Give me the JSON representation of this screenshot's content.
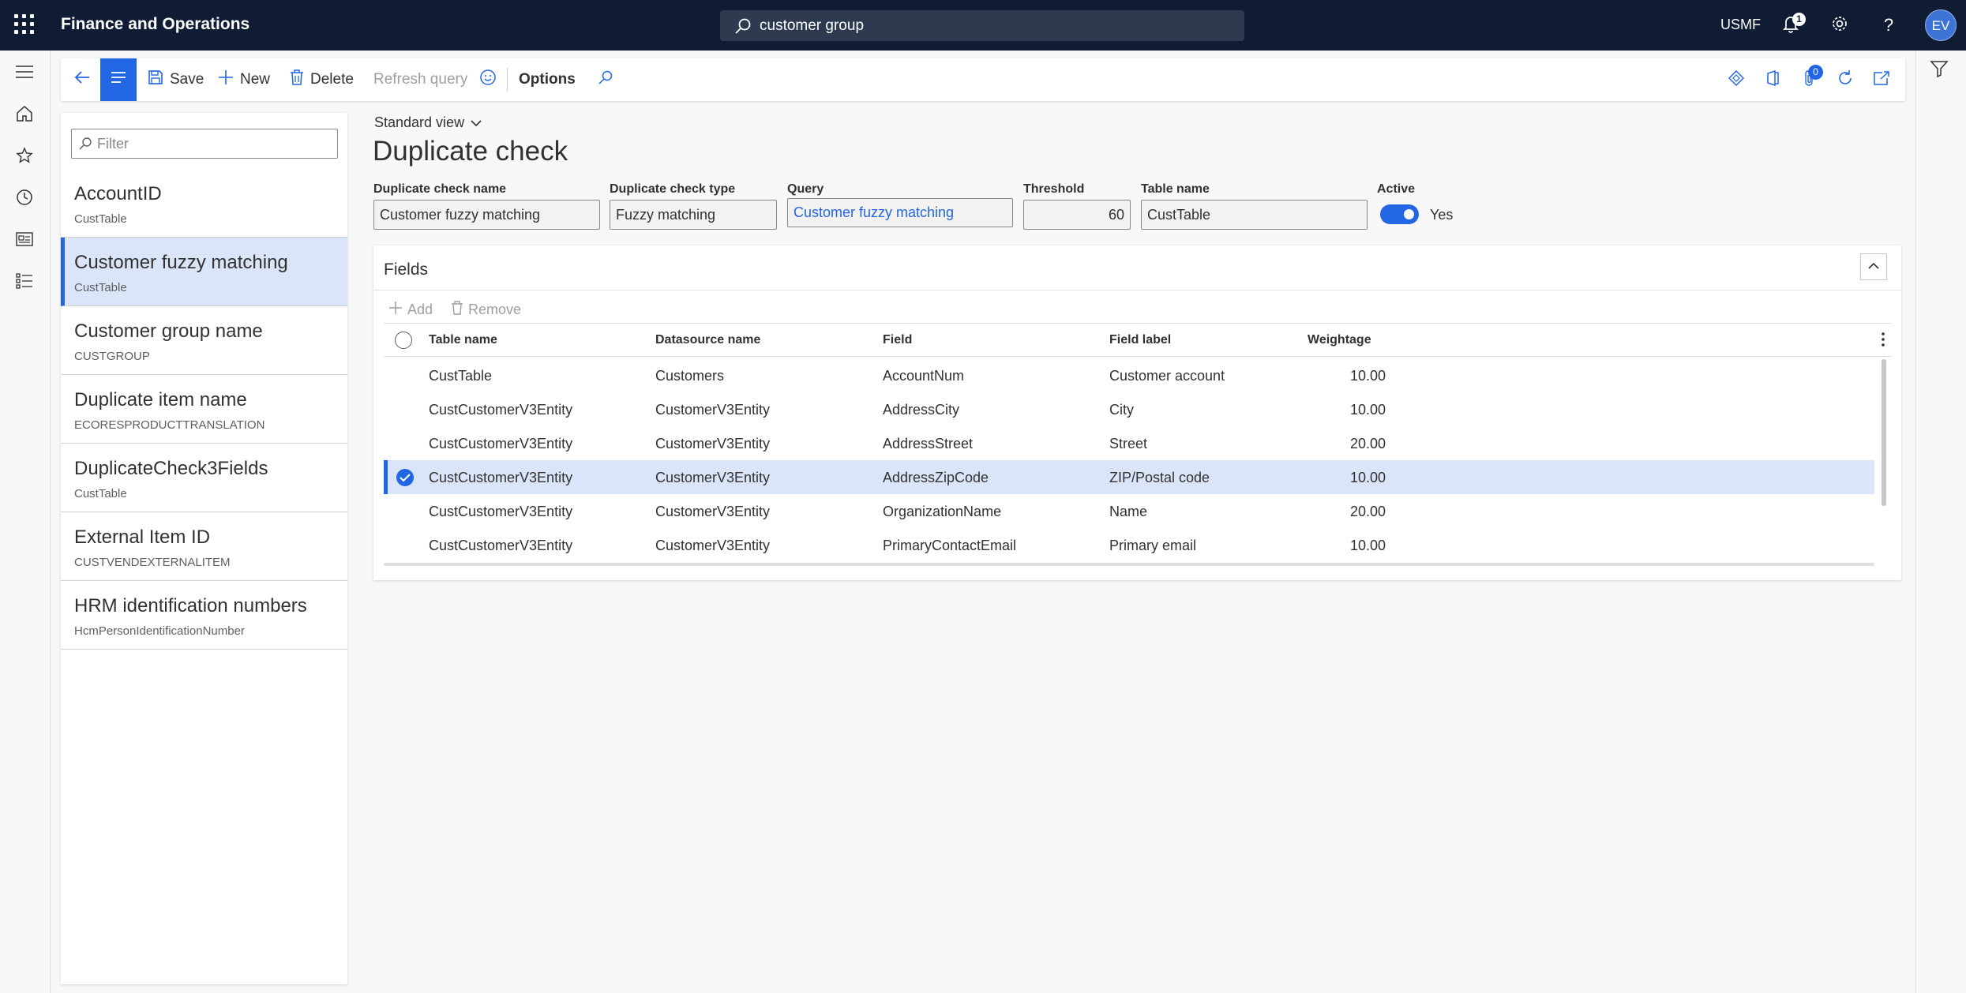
{
  "topbar": {
    "app_title": "Finance and Operations",
    "search_value": "customer group",
    "company": "USMF",
    "notification_count": "1",
    "avatar_initials": "EV"
  },
  "action_pane": {
    "save": "Save",
    "new": "New",
    "delete": "Delete",
    "refresh_query": "Refresh query",
    "options": "Options",
    "attachments_count": "0"
  },
  "list": {
    "filter_placeholder": "Filter",
    "items": [
      {
        "title": "AccountID",
        "subtitle": "CustTable"
      },
      {
        "title": "Customer fuzzy matching",
        "subtitle": "CustTable"
      },
      {
        "title": "Customer group name",
        "subtitle": "CUSTGROUP"
      },
      {
        "title": "Duplicate item name",
        "subtitle": "ECORESPRODUCTTRANSLATION"
      },
      {
        "title": "DuplicateCheck3Fields",
        "subtitle": "CustTable"
      },
      {
        "title": "External Item ID",
        "subtitle": "CUSTVENDEXTERNALITEM"
      },
      {
        "title": "HRM identification numbers",
        "subtitle": "HcmPersonIdentificationNumber"
      }
    ],
    "selected_index": 1
  },
  "header": {
    "view_name": "Standard view",
    "page_title": "Duplicate check",
    "fields": {
      "name_label": "Duplicate check name",
      "name_value": "Customer fuzzy matching",
      "type_label": "Duplicate check type",
      "type_value": "Fuzzy matching",
      "query_label": "Query",
      "query_value": "Customer fuzzy matching",
      "threshold_label": "Threshold",
      "threshold_value": "60",
      "table_label": "Table name",
      "table_value": "CustTable",
      "active_label": "Active",
      "active_value": "Yes"
    }
  },
  "fields_tab": {
    "title": "Fields",
    "add": "Add",
    "remove": "Remove",
    "columns": {
      "table_name": "Table name",
      "datasource_name": "Datasource name",
      "field": "Field",
      "field_label": "Field label",
      "weightage": "Weightage"
    },
    "rows": [
      {
        "table_name": "CustTable",
        "datasource_name": "Customers",
        "field": "AccountNum",
        "field_label": "Customer account",
        "weightage": "10.00"
      },
      {
        "table_name": "CustCustomerV3Entity",
        "datasource_name": "CustomerV3Entity",
        "field": "AddressCity",
        "field_label": "City",
        "weightage": "10.00"
      },
      {
        "table_name": "CustCustomerV3Entity",
        "datasource_name": "CustomerV3Entity",
        "field": "AddressStreet",
        "field_label": "Street",
        "weightage": "20.00"
      },
      {
        "table_name": "CustCustomerV3Entity",
        "datasource_name": "CustomerV3Entity",
        "field": "AddressZipCode",
        "field_label": "ZIP/Postal code",
        "weightage": "10.00"
      },
      {
        "table_name": "CustCustomerV3Entity",
        "datasource_name": "CustomerV3Entity",
        "field": "OrganizationName",
        "field_label": "Name",
        "weightage": "20.00"
      },
      {
        "table_name": "CustCustomerV3Entity",
        "datasource_name": "CustomerV3Entity",
        "field": "PrimaryContactEmail",
        "field_label": "Primary email",
        "weightage": "10.00"
      }
    ],
    "selected_row": 3
  },
  "colors": {
    "topbar_bg": "#0f1c33",
    "accent": "#2266e3",
    "selection_bg": "#dbe5fa"
  },
  "icons": {
    "topbar": [
      "waffle-icon",
      "search-icon",
      "bell-icon",
      "gear-icon",
      "help-icon"
    ],
    "leftnav": [
      "hamburger-icon",
      "home-icon",
      "star-icon",
      "clock-icon",
      "workspace-icon",
      "modules-icon"
    ],
    "action_right": [
      "diamond-icon",
      "office-icon",
      "paperclip-icon",
      "refresh-icon",
      "open-new-icon"
    ]
  }
}
